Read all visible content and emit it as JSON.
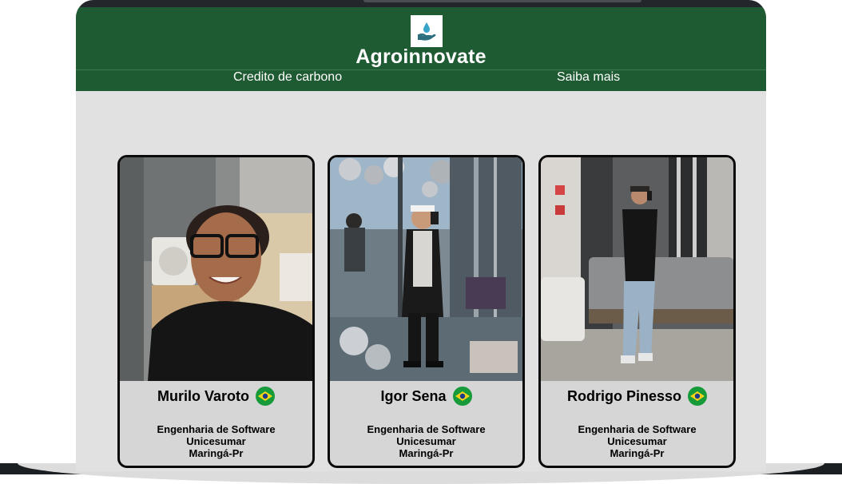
{
  "site": {
    "title": "Agroinnovate",
    "logo_icon": "plant-water-hand-icon"
  },
  "nav": {
    "items": [
      {
        "label": "Credito de carbono"
      },
      {
        "label": "Saiba mais"
      }
    ]
  },
  "colors": {
    "header_bg": "#1e5a32",
    "page_bg": "#e2e1e2",
    "card_bg": "#d7d6d6",
    "flag_green": "#169a3a",
    "flag_yellow": "#f6d31b",
    "flag_blue": "#1b3a8c"
  },
  "team": [
    {
      "name": "Murilo Varoto",
      "flag_icon": "brazil-flag-icon",
      "course": "Engenharia de Software",
      "university": "Unicesumar",
      "city": "Maringá-Pr"
    },
    {
      "name": "Igor Sena",
      "flag_icon": "brazil-flag-icon",
      "course": "Engenharia de Software",
      "university": "Unicesumar",
      "city": "Maringá-Pr"
    },
    {
      "name": "Rodrigo Pinesso",
      "flag_icon": "brazil-flag-icon",
      "course": "Engenharia de Software",
      "university": "Unicesumar",
      "city": "Maringá-Pr"
    }
  ]
}
